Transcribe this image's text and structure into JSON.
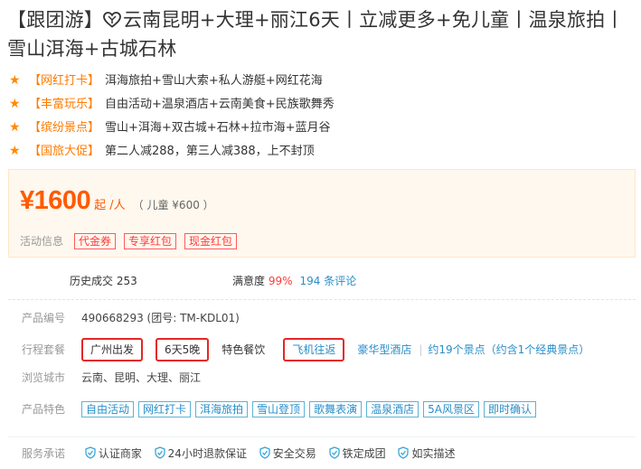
{
  "title": {
    "before_icon": "【跟团游】",
    "icon": "heart-icon",
    "after_icon": "云南昆明+大理+丽江6天丨立减更多+免儿童丨温泉旅拍丨雪山洱海+古城石林"
  },
  "features": [
    {
      "tag": "【网红打卡】",
      "desc": "洱海旅拍+雪山大索+私人游艇+网红花海"
    },
    {
      "tag": "【丰富玩乐】",
      "desc": "自由活动+温泉酒店+云南美食+民族歌舞秀"
    },
    {
      "tag": "【缤纷景点】",
      "desc": "雪山+洱海+双古城+石林+拉市海+蓝月谷"
    },
    {
      "tag": "【国旅大促】",
      "desc": "第二人减288，第三人减388，上不封顶"
    }
  ],
  "price": {
    "amount": "¥1600",
    "unit": "起 /人",
    "child": "（ 儿童 ¥600 ）"
  },
  "promo": {
    "label": "活动信息",
    "coupons": [
      "代金券",
      "专享红包",
      "现金红包"
    ]
  },
  "stats": {
    "sales_label": "历史成交 253",
    "satisfaction_label": "满意度",
    "satisfaction_value": "99%",
    "reviews": "194 条评论"
  },
  "product": {
    "id_label": "产品编号",
    "id_value": "490668293 (团号: TM-KDL01)",
    "itinerary_label": "行程套餐",
    "departure": "广州出发",
    "duration": "6天5晚",
    "meal": "特色餐饮",
    "transport": "飞机往返",
    "hotel": "豪华型酒店",
    "spots": "约19个景点（约含1个经典景点）",
    "cities_label": "浏览城市",
    "cities": "云南、昆明、大理、丽江",
    "features_label": "产品特色",
    "feature_tags": [
      "自由活动",
      "网红打卡",
      "洱海旅拍",
      "雪山登顶",
      "歌舞表演",
      "温泉酒店",
      "5A风景区",
      "即时确认"
    ]
  },
  "promise": {
    "label": "服务承诺",
    "items": [
      "认证商家",
      "24小时退款保证",
      "安全交易",
      "铁定成团",
      "如实描述"
    ]
  },
  "colors": {
    "accent_orange": "#ff7b00",
    "price_red": "#ff5a00",
    "link_blue": "#2a8ec8",
    "highlight_red": "#e62626"
  }
}
